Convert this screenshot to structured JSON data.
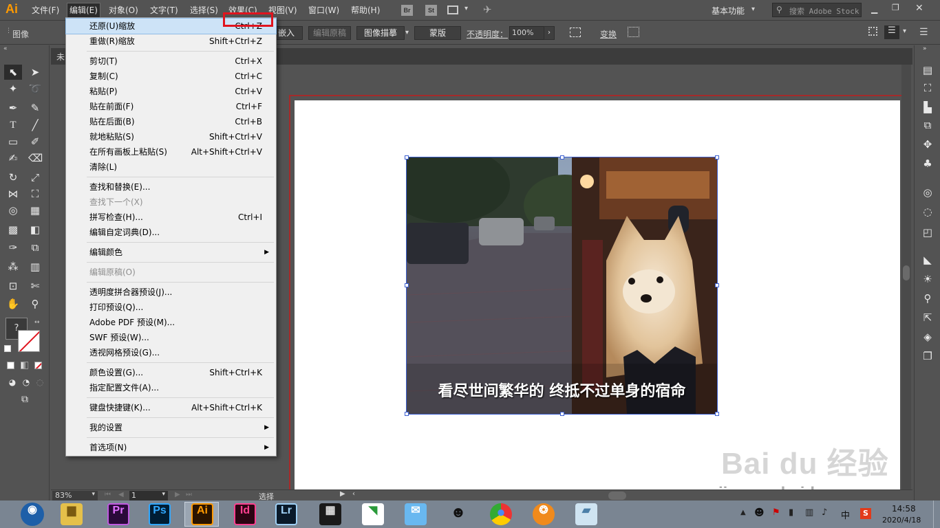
{
  "app": {
    "logo": "Ai",
    "workspace": "基本功能",
    "search_placeholder": "搜索 Adobe Stock",
    "bridge": "Br",
    "stock": "St"
  },
  "menubar": [
    "文件(F)",
    "编辑(E)",
    "对象(O)",
    "文字(T)",
    "选择(S)",
    "效果(C)",
    "视图(V)",
    "窗口(W)",
    "帮助(H)"
  ],
  "control": {
    "label": "图像",
    "embed": "嵌入",
    "edit_original": "编辑原稿",
    "image_trace": "图像描摹",
    "mask": "蒙版",
    "opacity_label": "不透明度：",
    "opacity_value": "100%",
    "transform": "变换"
  },
  "tab": {
    "title": "未"
  },
  "edit_menu": [
    {
      "label": "还原(U)缩放",
      "shortcut": "Ctrl+Z",
      "state": "highlight"
    },
    {
      "label": "重做(R)缩放",
      "shortcut": "Shift+Ctrl+Z"
    },
    {
      "sep": true
    },
    {
      "label": "剪切(T)",
      "shortcut": "Ctrl+X"
    },
    {
      "label": "复制(C)",
      "shortcut": "Ctrl+C"
    },
    {
      "label": "粘贴(P)",
      "shortcut": "Ctrl+V"
    },
    {
      "label": "贴在前面(F)",
      "shortcut": "Ctrl+F"
    },
    {
      "label": "贴在后面(B)",
      "shortcut": "Ctrl+B"
    },
    {
      "label": "就地粘贴(S)",
      "shortcut": "Shift+Ctrl+V"
    },
    {
      "label": "在所有画板上粘贴(S)",
      "shortcut": "Alt+Shift+Ctrl+V"
    },
    {
      "label": "清除(L)",
      "shortcut": ""
    },
    {
      "sep": true
    },
    {
      "label": "查找和替换(E)...",
      "shortcut": ""
    },
    {
      "label": "查找下一个(X)",
      "shortcut": "",
      "state": "disabled"
    },
    {
      "label": "拼写检查(H)...",
      "shortcut": "Ctrl+I"
    },
    {
      "label": "编辑自定词典(D)...",
      "shortcut": ""
    },
    {
      "sep": true
    },
    {
      "label": "编辑颜色",
      "shortcut": "",
      "submenu": true
    },
    {
      "sep": true
    },
    {
      "label": "编辑原稿(O)",
      "shortcut": "",
      "state": "disabled"
    },
    {
      "sep": true
    },
    {
      "label": "透明度拼合器预设(J)...",
      "shortcut": ""
    },
    {
      "label": "打印预设(Q)...",
      "shortcut": ""
    },
    {
      "label": "Adobe PDF 预设(M)...",
      "shortcut": ""
    },
    {
      "label": "SWF 预设(W)...",
      "shortcut": ""
    },
    {
      "label": "透视网格预设(G)...",
      "shortcut": ""
    },
    {
      "sep": true
    },
    {
      "label": "颜色设置(G)...",
      "shortcut": "Shift+Ctrl+K"
    },
    {
      "label": "指定配置文件(A)...",
      "shortcut": ""
    },
    {
      "sep": true
    },
    {
      "label": "键盘快捷键(K)...",
      "shortcut": "Alt+Shift+Ctrl+K"
    },
    {
      "sep": true
    },
    {
      "label": "我的设置",
      "shortcut": "",
      "submenu": true
    },
    {
      "sep": true
    },
    {
      "label": "首选项(N)",
      "shortcut": "",
      "submenu": true
    }
  ],
  "photo": {
    "caption": "看尽世间繁华的 终抵不过单身的宿命"
  },
  "status": {
    "zoom": "83%",
    "page": "1",
    "tool": "选择"
  },
  "watermark": {
    "brand": "Bai du 经验",
    "url": "jingyan.baidu.com"
  },
  "taskbar": {
    "apps": [
      "Pr",
      "Ps",
      "Ai",
      "Id",
      "Lr"
    ],
    "time": "14:58",
    "date": "2020/4/18",
    "ime": "中"
  }
}
